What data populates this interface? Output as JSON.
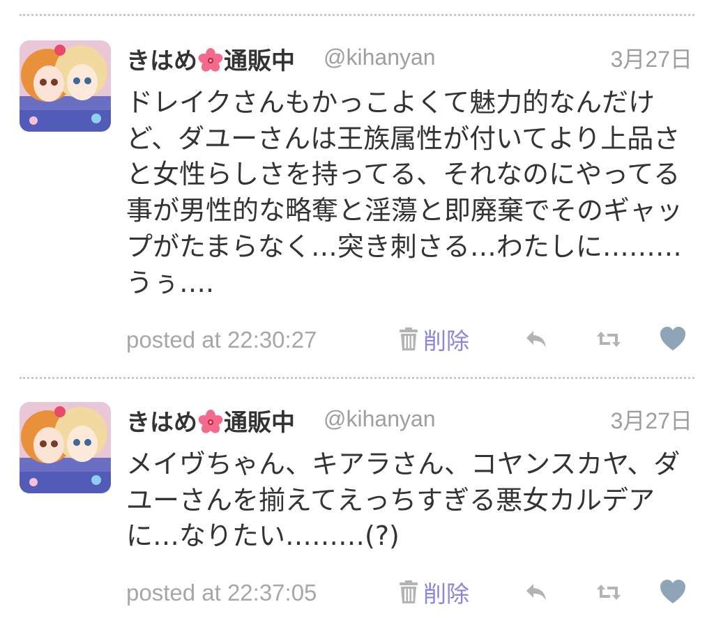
{
  "colors": {
    "text": "#333333",
    "muted": "#9e9e9e",
    "link": "#8a86d8",
    "heart": "#8fa4b6",
    "icon": "#b3b3b3"
  },
  "tweets": [
    {
      "name_before": "きはめ",
      "name_after": "通販中",
      "name_icon": "hibiscus-flower-icon",
      "handle": "@kihanyan",
      "date": "3月27日",
      "text": "ドレイクさんもかっこよくて魅力的なんだけど、ダユーさんは王族属性が付いてより上品さと女性らしさを持ってる、それなのにやってる事が男性的な略奪と淫蕩と即廃棄でそのギャップがたまらなく…突き刺さる…わたしに………うぅ….",
      "posted": "posted at 22:30:27",
      "delete_label": "削除",
      "actions": [
        "reply-icon",
        "retweet-icon",
        "heart-icon"
      ]
    },
    {
      "name_before": "きはめ",
      "name_after": "通販中",
      "name_icon": "hibiscus-flower-icon",
      "handle": "@kihanyan",
      "date": "3月27日",
      "text": "メイヴちゃん、キアラさん、コヤンスカヤ、ダユーさんを揃えてえっちすぎる悪女カルデアに…なりたい………(?)",
      "posted": "posted at 22:37:05",
      "delete_label": "削除",
      "actions": [
        "reply-icon",
        "retweet-icon",
        "heart-icon"
      ]
    }
  ]
}
